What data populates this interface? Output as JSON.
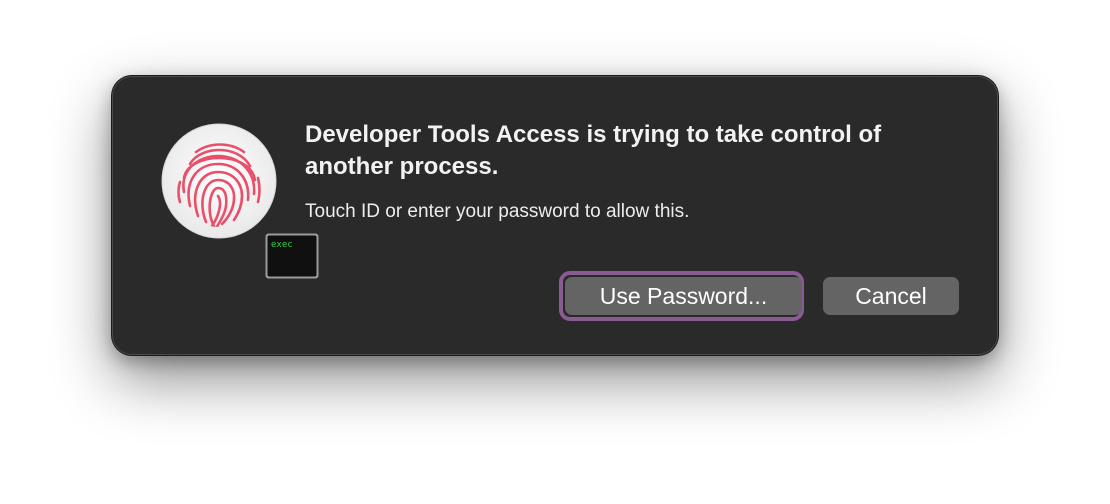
{
  "dialog": {
    "title": "Developer Tools Access is trying to take control of another process.",
    "message": "Touch ID or enter your password to allow this.",
    "buttons": {
      "use_password": "Use Password...",
      "cancel": "Cancel"
    },
    "icon": {
      "main": "fingerprint-icon",
      "badge": "terminal-icon",
      "badge_text": "exec"
    }
  },
  "colors": {
    "dialog_background": "#2a2a2a",
    "button_background": "#646464",
    "focus_ring": "#8a5a93",
    "fingerprint": "#ea4f6a",
    "badge_text": "#33d14a"
  }
}
